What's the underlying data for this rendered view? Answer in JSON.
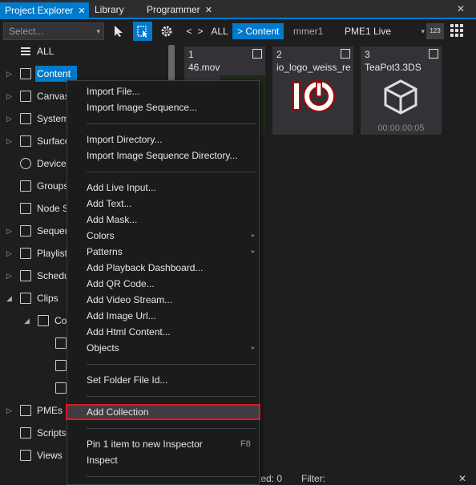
{
  "tabs": [
    {
      "label": "Project Explorer",
      "close": "✕"
    },
    {
      "label": "Library"
    },
    {
      "label": "Programmer",
      "close": "✕"
    }
  ],
  "window_close": "✕",
  "left_toolbar": {
    "select_placeholder": "Select...",
    "caret": "▾"
  },
  "tree": {
    "items": [
      {
        "label": "ALL"
      },
      {
        "label": "Content",
        "arrow": "▷"
      },
      {
        "label": "Canvas",
        "arrow": "▷"
      },
      {
        "label": "System",
        "arrow": "▷"
      },
      {
        "label": "Surface",
        "arrow": "▷"
      },
      {
        "label": "Device"
      },
      {
        "label": "Groups"
      },
      {
        "label": "Node S"
      },
      {
        "label": "Sequen",
        "arrow": "▷"
      },
      {
        "label": "Playlist",
        "arrow": "▷"
      },
      {
        "label": "Schedu",
        "arrow": "▷"
      },
      {
        "label": "Clips",
        "arrow": "◢"
      },
      {
        "label": "Co",
        "arrow": "◢"
      },
      {
        "label": ""
      },
      {
        "label": ""
      },
      {
        "label": ""
      },
      {
        "label": "PMEs",
        "arrow": "▷"
      },
      {
        "label": "Scripts"
      },
      {
        "label": "Views"
      }
    ]
  },
  "right_toolbar": {
    "back": "<",
    "forward": ">",
    "crumb_all": "ALL",
    "crumb_content": "> Content",
    "programmer_partial": "mmer1",
    "live_label": "PME1 Live",
    "caret": "▾",
    "num_label": "123"
  },
  "thumbnails": [
    {
      "index": "1",
      "name": "46.mov",
      "time": ""
    },
    {
      "index": "2",
      "name": "io_logo_weiss_re...",
      "time": ""
    },
    {
      "index": "3",
      "name": "TeaPot3.3DS",
      "time": "00:00:00:05"
    }
  ],
  "menu": {
    "items": [
      {
        "label": "Import File..."
      },
      {
        "label": "Import Image Sequence..."
      },
      {
        "label": "Import Directory..."
      },
      {
        "label": "Import Image Sequence Directory..."
      },
      {
        "label": "Add Live Input..."
      },
      {
        "label": "Add Text..."
      },
      {
        "label": "Add Mask..."
      },
      {
        "label": "Colors",
        "sub": "▸"
      },
      {
        "label": "Patterns",
        "sub": "▸"
      },
      {
        "label": "Add Playback Dashboard..."
      },
      {
        "label": "Add QR Code..."
      },
      {
        "label": "Add Video Stream..."
      },
      {
        "label": "Add Image Url..."
      },
      {
        "label": "Add Html Content..."
      },
      {
        "label": "Objects",
        "sub": "▸"
      },
      {
        "label": "Set Folder File Id..."
      },
      {
        "label": "Add Collection"
      },
      {
        "label": "Pin 1 item to new Inspector",
        "shortcut": "F8"
      },
      {
        "label": "Inspect"
      }
    ]
  },
  "status": {
    "selected": "cted: 0",
    "filter": "Filter:",
    "close": "✕"
  }
}
